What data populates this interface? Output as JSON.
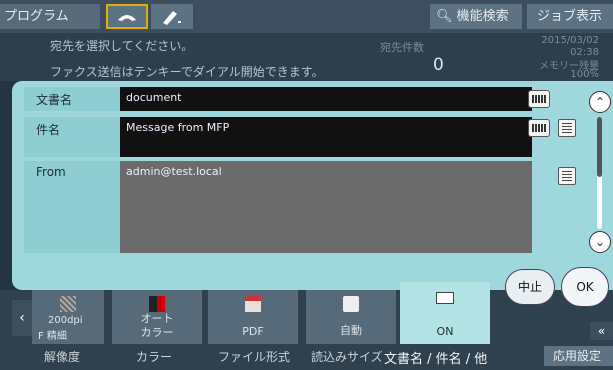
{
  "topbar": {
    "program": "プログラム",
    "search": "機能検索",
    "job_display": "ジョブ表示"
  },
  "info": {
    "message_line1": "宛先を選択してください。",
    "message_line2": "ファクス送信はテンキーでダイアル開始できます。",
    "destination_label": "宛先件数",
    "destination_count": "0",
    "date": "2015/03/02",
    "time": "02:38",
    "memory_label": "メモリー残量",
    "memory_value": "100%"
  },
  "dialog": {
    "docname_label": "文書名",
    "docname_value": "document",
    "subject_label": "件名",
    "subject_value": "Message from MFP",
    "from_label": "From",
    "from_value": "admin@test.local",
    "cancel": "中止",
    "ok": "OK"
  },
  "bottom": {
    "res_line1": "200dpi",
    "res_line2": "F 精細",
    "res_caption": "解像度",
    "color_line1": "オート",
    "color_line2": "カラー",
    "color_caption": "カラー",
    "format_value": "PDF",
    "format_caption": "ファイル形式",
    "size_value": "自動",
    "size_caption": "読込みサイズ",
    "docname_value": "ON",
    "docname_caption": "文書名 / 件名 / 他",
    "app_settings": "応用設定"
  },
  "icons": [
    "phone-icon",
    "pen-icon",
    "search-icon",
    "keyboard-icon",
    "document-icon",
    "scroll-up-icon",
    "scroll-down-icon",
    "left-arrow-icon",
    "right-arrow-icon",
    "mail-icon"
  ]
}
